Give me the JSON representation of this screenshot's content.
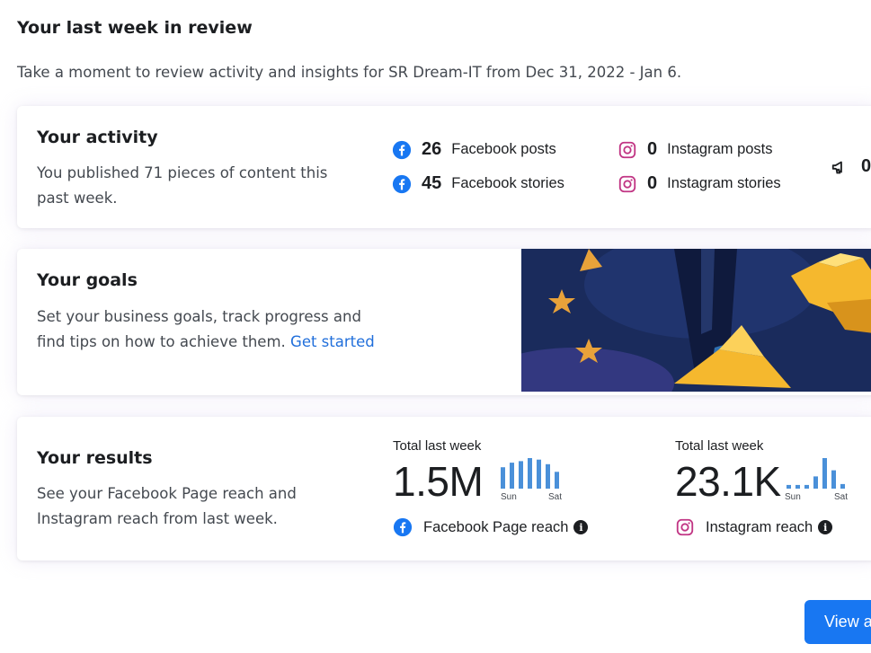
{
  "page": {
    "title": "Your last week in review",
    "subtitle": "Take a moment to review activity and insights for SR Dream-IT from Dec 31, 2022 - Jan 6."
  },
  "activity": {
    "title": "Your activity",
    "description": "You published 71 pieces of content this past week.",
    "stats": [
      {
        "value": "26",
        "label": "Facebook posts",
        "icon": "facebook-icon"
      },
      {
        "value": "45",
        "label": "Facebook stories",
        "icon": "facebook-icon"
      },
      {
        "value": "0",
        "label": "Instagram posts",
        "icon": "instagram-icon"
      },
      {
        "value": "0",
        "label": "Instagram stories",
        "icon": "instagram-icon"
      }
    ],
    "cutoff_stat": {
      "value": "0",
      "icon": "megaphone-icon"
    }
  },
  "goals": {
    "title": "Your goals",
    "description": "Set your business goals, track progress and find tips on how to achieve them.",
    "link": "Get started",
    "banner_colors": {
      "sky": "#1a2b5c",
      "star": "#f5b82e"
    }
  },
  "results": {
    "title": "Your results",
    "description": "See your Facebook Page reach and Instagram reach from last week.",
    "metrics": [
      {
        "caption": "Total last week",
        "value": "1.5M",
        "label": "Facebook Page reach",
        "icon": "facebook-icon",
        "spark_start": "Sun",
        "spark_end": "Sat",
        "daily": [
          0.7,
          0.85,
          0.9,
          1.0,
          0.95,
          0.8,
          0.55
        ]
      },
      {
        "caption": "Total last week",
        "value": "23.1K",
        "label": "Instagram reach",
        "icon": "instagram-icon",
        "spark_start": "Sun",
        "spark_end": "Sat",
        "daily": [
          0.12,
          0.12,
          0.12,
          0.4,
          1.0,
          0.6,
          0.15
        ]
      }
    ]
  },
  "footer": {
    "button_label": "View a"
  },
  "colors": {
    "accent": "#1877f2",
    "facebook": "#1877f2",
    "instagram": "#c13584",
    "link": "#216fdb",
    "spark": "#4a90d9"
  }
}
